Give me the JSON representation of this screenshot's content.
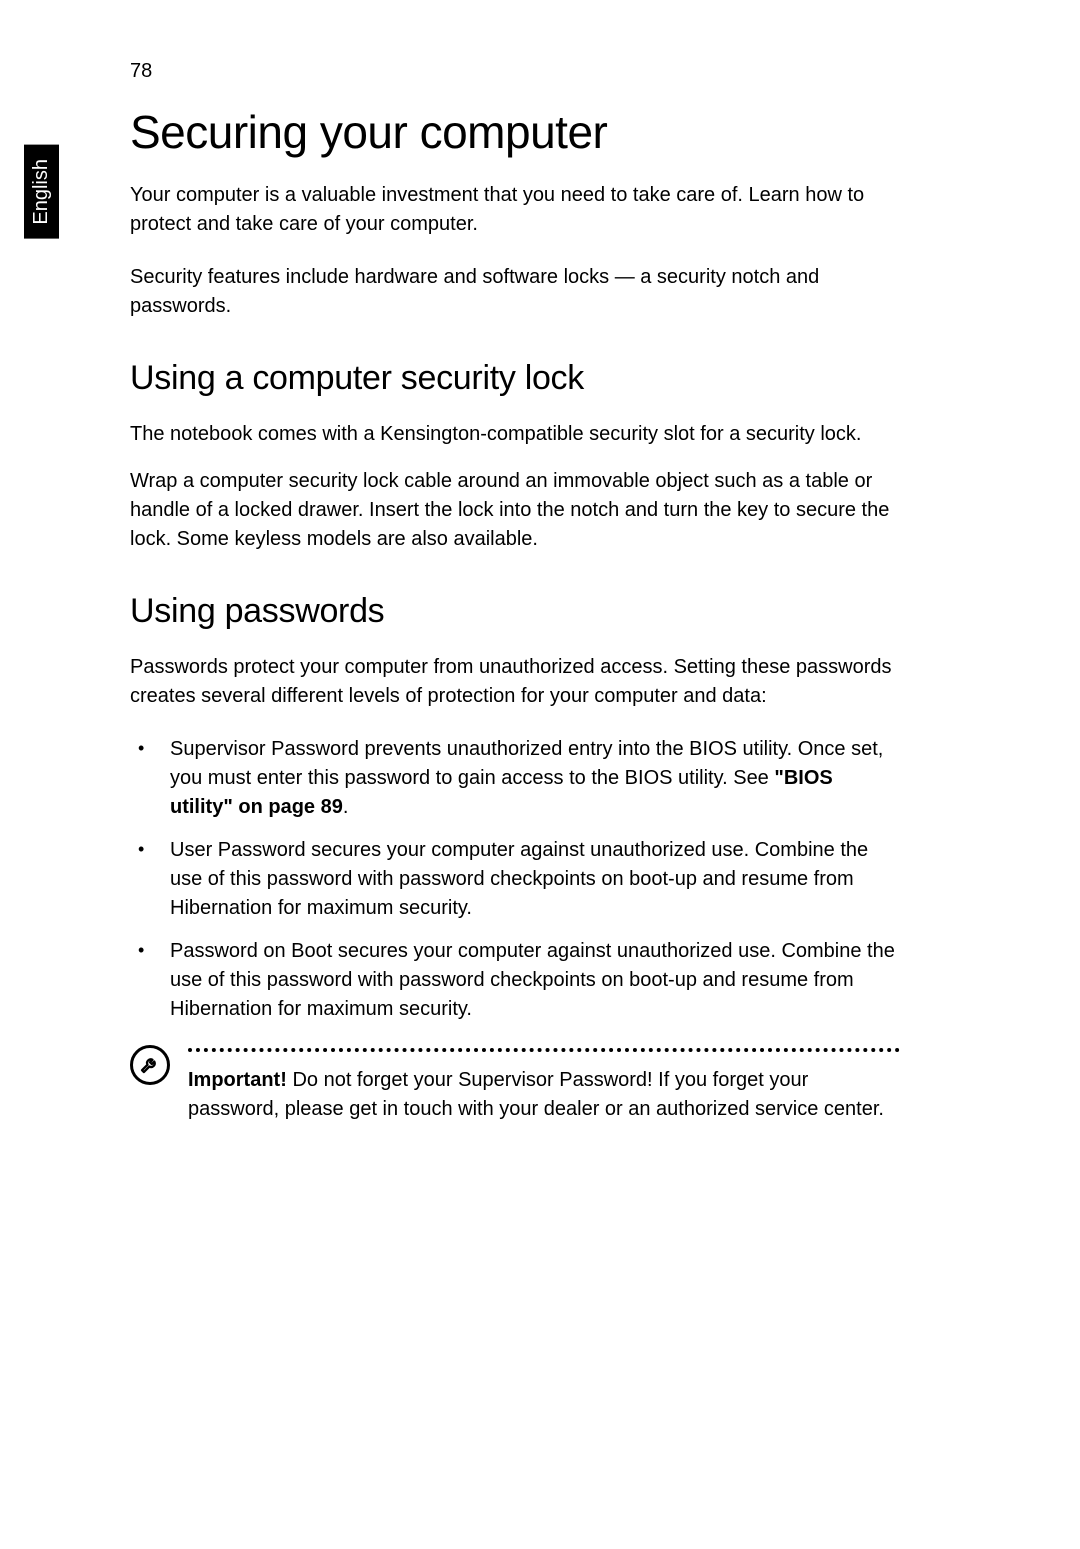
{
  "sidebar": {
    "language": "English"
  },
  "pageNumber": "78",
  "heading1": "Securing your computer",
  "intro1": "Your computer is a valuable investment that you need to take care of. Learn how to protect and take care of your computer.",
  "intro2": "Security features include hardware and software locks — a security notch and passwords.",
  "section1": {
    "heading": "Using a computer security lock",
    "p1": "The notebook comes with a Kensington-compatible security slot for a security lock.",
    "p2": "Wrap a computer security lock cable around an immovable object such as a table or handle of a locked drawer. Insert the lock into the notch and turn the key to secure the lock. Some keyless models are also available."
  },
  "section2": {
    "heading": "Using passwords",
    "p1": "Passwords protect your computer from unauthorized access. Setting these passwords creates several different levels of protection for your computer and data:",
    "bullets": [
      {
        "pre": "Supervisor Password prevents unauthorized entry into the BIOS utility. Once set, you must enter this password to gain access to the BIOS utility. See ",
        "bold": "\"BIOS utility\" on page 89",
        "post": "."
      },
      {
        "pre": "User Password secures your computer against unauthorized use. Combine the use of this password with password checkpoints on boot-up and resume from Hibernation for maximum security.",
        "bold": "",
        "post": ""
      },
      {
        "pre": "Password on Boot secures your computer against unauthorized use. Combine the use of this password with password checkpoints on boot-up and resume from Hibernation for maximum security.",
        "bold": "",
        "post": ""
      }
    ],
    "note": {
      "boldLabel": "Important!",
      "text": " Do not forget your Supervisor Password! If you forget your password, please get in touch with your dealer or an authorized service center."
    }
  }
}
